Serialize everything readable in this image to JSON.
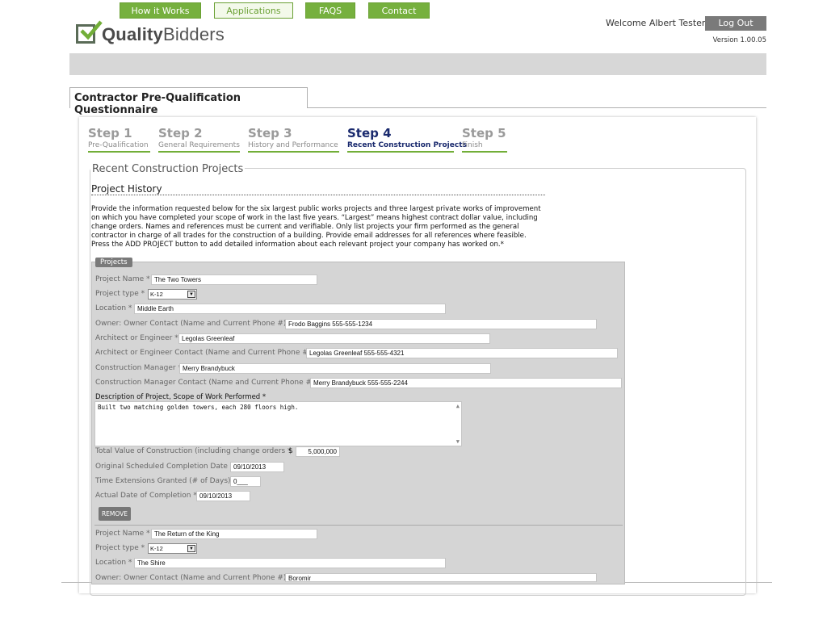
{
  "brand": {
    "name_bold": "Quality",
    "name_regular": "Bidders"
  },
  "header": {
    "welcome": "Welcome Albert Tester",
    "logout_label": "Log Out",
    "version": "Version 1.00.05"
  },
  "nav": {
    "items": [
      {
        "label": "How it Works",
        "active": false
      },
      {
        "label": "Applications",
        "active": true
      },
      {
        "label": "FAQS",
        "active": false
      },
      {
        "label": "Contact",
        "active": false
      }
    ]
  },
  "page_tab": "Contractor Pre-Qualification Questionnaire",
  "steps": [
    {
      "num": "Step 1",
      "label": "Pre-Qualification",
      "current": false
    },
    {
      "num": "Step 2",
      "label": "General Requirements",
      "current": false
    },
    {
      "num": "Step 3",
      "label": "History and Performance",
      "current": false
    },
    {
      "num": "Step 4",
      "label": "Recent Construction Projects",
      "current": true
    },
    {
      "num": "Step 5",
      "label": "Finish",
      "current": false
    }
  ],
  "section": {
    "title": "Recent Construction Projects",
    "subtitle": "Project History",
    "intro_lines": [
      "Provide the information requested below for the six largest public works projects and three largest private works of improvement",
      "on which you have completed your scope of work in the last five years. “Largest” means highest contract dollar value, including",
      "change orders. Names and references must be current and verifiable. Only list projects your firm performed as the general",
      "contractor in charge of all trades for the construction of a building. Provide email addresses for all references where feasible.",
      "Press the ADD PROJECT button to add detailed information about each relevant project your company has worked on.*"
    ],
    "projects_legend": "Projects"
  },
  "labels": {
    "project_name": "Project Name *",
    "project_type": "Project type *",
    "location": "Location *",
    "owner_contact": "Owner: Owner Contact (Name and Current Phone #) *",
    "architect": "Architect or Engineer *",
    "architect_contact": "Architect or Engineer Contact (Name and Current Phone # *",
    "cm": "Construction Manager *",
    "cm_contact": "Construction Manager Contact (Name and Current Phone #) *",
    "description": "Description of Project, Scope of Work Performed *",
    "total_value": "Total Value of Construction (including change orders *",
    "orig_completion": "Original Scheduled Completion Date *",
    "extensions": "Time Extensions Granted (# of Days) *",
    "actual_completion": "Actual Date of Completion *",
    "remove_button": "REMOVE",
    "currency": "$"
  },
  "projects": [
    {
      "name": "The Two Towers",
      "type": "K-12",
      "location": "Middle Earth",
      "owner_contact": "Frodo Baggins 555-555-1234",
      "architect": "Legolas Greenleaf",
      "architect_contact": "Legolas Greenleaf 555-555-4321",
      "cm": "Merry Brandybuck",
      "cm_contact": "Merry Brandybuck 555-555-2244",
      "description": "Built two matching golden towers, each 280 floors high.",
      "total_value": "5,000,000",
      "orig_completion": "09/10/2013",
      "extensions": "0___",
      "actual_completion": "09/10/2013"
    },
    {
      "name": "The Return of the King",
      "type": "K-12",
      "location": "The Shire",
      "owner_contact": "Boromir"
    }
  ]
}
